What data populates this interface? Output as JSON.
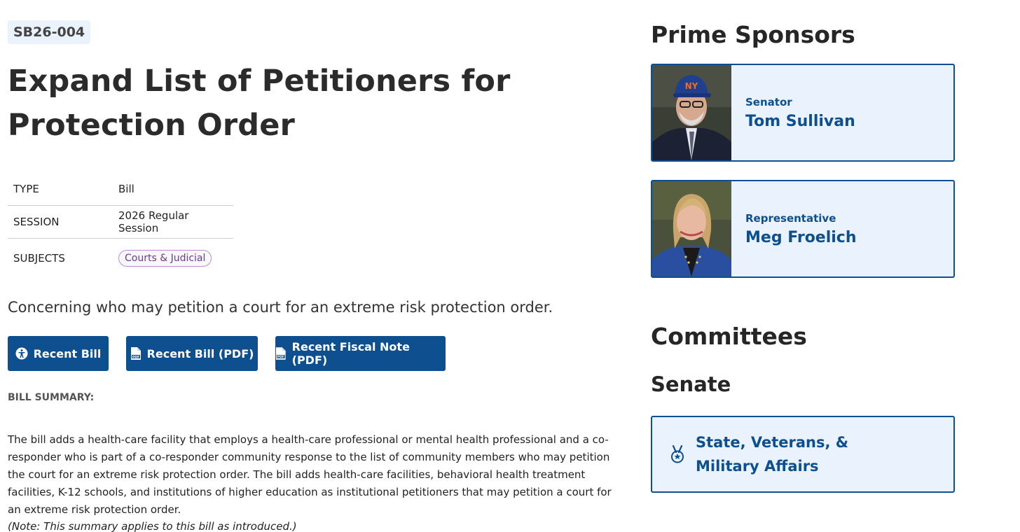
{
  "bill": {
    "number": "SB26-004",
    "title": "Expand List of Petitioners for Protection Order",
    "meta": {
      "type_label": "TYPE",
      "type_value": "Bill",
      "session_label": "SESSION",
      "session_value": "2026 Regular Session",
      "subjects_label": "SUBJECTS",
      "subject_tag": "Courts & Judicial"
    },
    "description": "Concerning who may petition a court for an extreme risk protection order.",
    "buttons": {
      "recent_bill": "Recent Bill",
      "recent_bill_pdf": "Recent Bill (PDF)",
      "recent_fiscal_note_pdf": "Recent Fiscal Note (PDF)"
    },
    "summary_heading": "BILL SUMMARY:",
    "summary_text": "The bill adds a health-care facility that employs a health-care professional or mental health professional and a co-responder who is part of a co-responder community response to the list of community members who may petition the court for an extreme risk protection order. The bill adds health-care facilities, behavioral health treatment facilities, K-12 schools, and institutions of higher education as institutional petitioners that may petition a court for an extreme risk protection order.",
    "summary_note": "(Note: This summary applies to this bill as introduced.)"
  },
  "sponsors": {
    "heading": "Prime Sponsors",
    "list": [
      {
        "role": "Senator",
        "name": "Tom Sullivan"
      },
      {
        "role": "Representative",
        "name": "Meg Froelich"
      }
    ]
  },
  "committees": {
    "heading": "Committees",
    "chamber": "Senate",
    "list": [
      {
        "name": "State, Veterans, & Military Affairs",
        "icon": "medal-icon"
      }
    ]
  },
  "colors": {
    "primary": "#0d4f8f",
    "card_bg": "#eaf3fd",
    "tag_border": "#b98ed6",
    "tag_text": "#6a3d8a"
  }
}
